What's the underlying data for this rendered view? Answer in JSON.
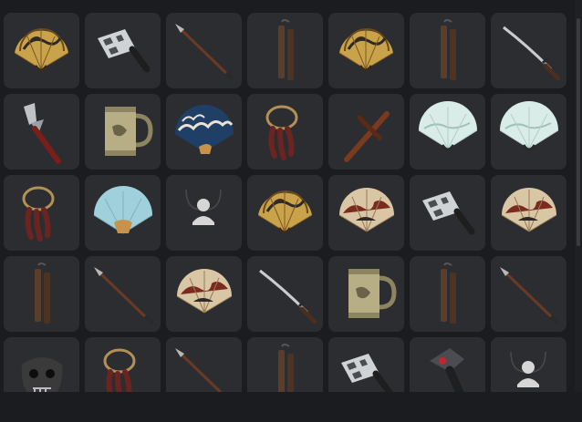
{
  "colors": {
    "background": "#1b1c1f",
    "tile": "#2c2d31"
  },
  "grid": {
    "items": [
      {
        "icon": "golden-fan-icon"
      },
      {
        "icon": "cleaver-icon"
      },
      {
        "icon": "spear-icon"
      },
      {
        "icon": "nunchaku-icon"
      },
      {
        "icon": "golden-fan-icon"
      },
      {
        "icon": "nunchaku-icon"
      },
      {
        "icon": "katana-icon"
      },
      {
        "icon": "kunai-icon"
      },
      {
        "icon": "tankard-icon"
      },
      {
        "icon": "wave-fan-icon"
      },
      {
        "icon": "claw-necklace-icon"
      },
      {
        "icon": "tonfa-icon"
      },
      {
        "icon": "white-fan-icon"
      },
      {
        "icon": "white-fan-icon"
      },
      {
        "icon": "claw-necklace-icon"
      },
      {
        "icon": "blue-fan-icon"
      },
      {
        "icon": "avatar-placeholder-icon"
      },
      {
        "icon": "golden-fan-icon"
      },
      {
        "icon": "red-fan-icon"
      },
      {
        "icon": "cleaver-icon"
      },
      {
        "icon": "red-fan-icon"
      },
      {
        "icon": "nunchaku-icon"
      },
      {
        "icon": "spear-icon"
      },
      {
        "icon": "red-fan-icon"
      },
      {
        "icon": "katana-icon"
      },
      {
        "icon": "tankard-icon"
      },
      {
        "icon": "nunchaku-icon"
      },
      {
        "icon": "spear-icon"
      },
      {
        "icon": "skull-mask-icon"
      },
      {
        "icon": "claw-necklace-icon"
      },
      {
        "icon": "spear-icon"
      },
      {
        "icon": "nunchaku-icon"
      },
      {
        "icon": "cleaver-icon"
      },
      {
        "icon": "mech-arm-icon"
      },
      {
        "icon": "avatar-placeholder-icon"
      }
    ]
  }
}
